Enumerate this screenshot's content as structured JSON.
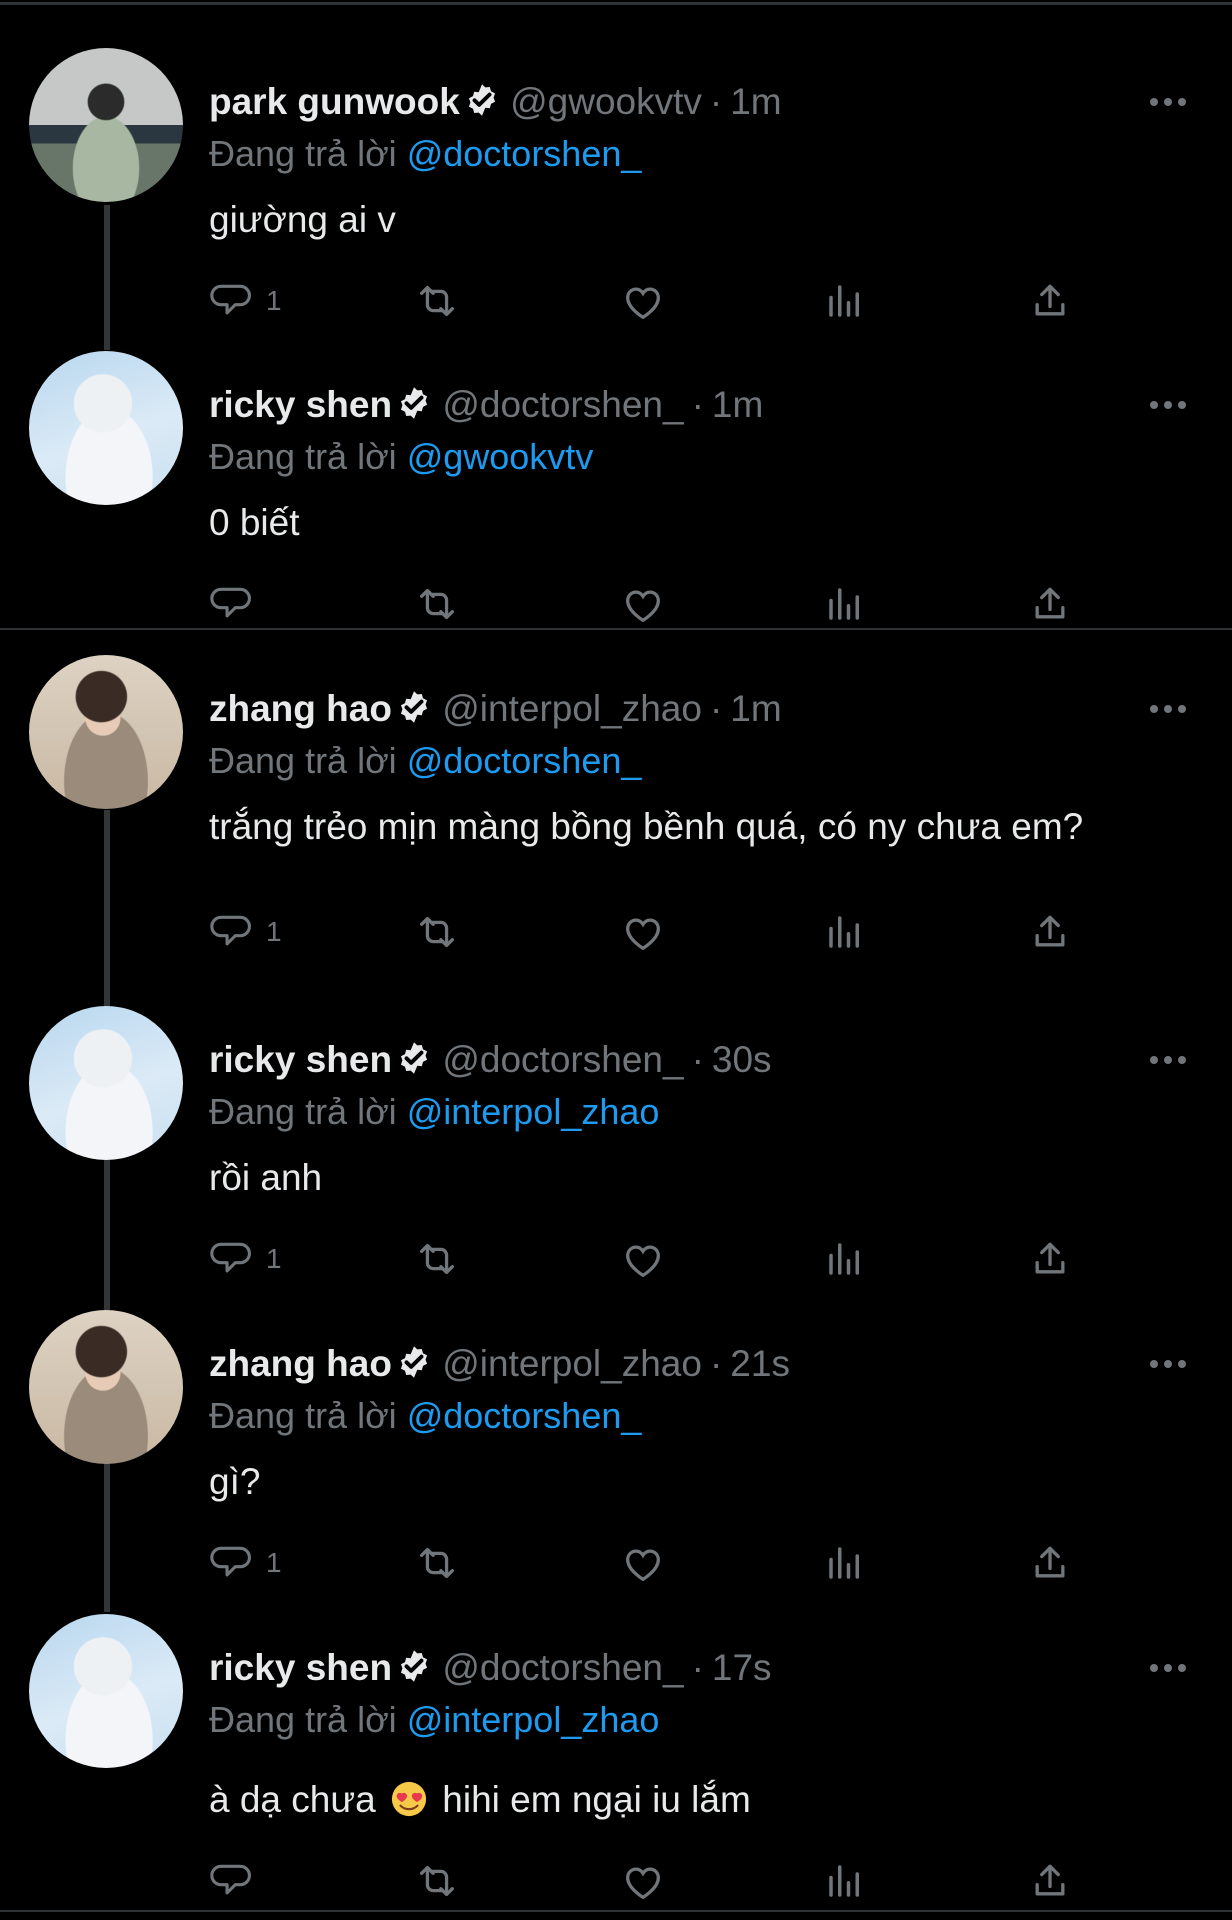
{
  "tweets": [
    {
      "name": "park gunwook",
      "handle": "@gwookvtv",
      "time": "1m",
      "replying_label": "Đang trả lời",
      "replying_to": "@doctorshen_",
      "text": "giường ai v",
      "reply_count": "1"
    },
    {
      "name": "ricky shen",
      "handle": "@doctorshen_",
      "time": "1m",
      "replying_label": "Đang trả lời",
      "replying_to": "@gwookvtv",
      "text": "0 biết",
      "reply_count": ""
    },
    {
      "name": "zhang hao",
      "handle": "@interpol_zhao",
      "time": "1m",
      "replying_label": "Đang trả lời",
      "replying_to": "@doctorshen_",
      "text": "trắng trẻo mịn màng bồng bềnh quá, có ny chưa em?",
      "reply_count": "1"
    },
    {
      "name": "ricky shen",
      "handle": "@doctorshen_",
      "time": "30s",
      "replying_label": "Đang trả lời",
      "replying_to": "@interpol_zhao",
      "text": "rồi anh",
      "reply_count": "1"
    },
    {
      "name": "zhang hao",
      "handle": "@interpol_zhao",
      "time": "21s",
      "replying_label": "Đang trả lời",
      "replying_to": "@doctorshen_",
      "text": "gì?",
      "reply_count": "1"
    },
    {
      "name": "ricky shen",
      "handle": "@doctorshen_",
      "time": "17s",
      "replying_label": "Đang trả lời",
      "replying_to": "@interpol_zhao",
      "text_before_emoji": "à dạ chưa",
      "emoji": "smiling-face-with-heart-eyes",
      "text_after_emoji": "hihi em ngại iu lắm",
      "reply_count": ""
    }
  ],
  "separator": "·",
  "icons": [
    "more-icon",
    "verified-icon",
    "reply-icon",
    "retweet-icon",
    "like-icon",
    "views-icon",
    "share-icon"
  ],
  "colors": {
    "background": "#000000",
    "primary_text": "#e7e9ea",
    "secondary_text": "#71767b",
    "mention": "#1d9bf0",
    "divider": "#2f3336"
  }
}
